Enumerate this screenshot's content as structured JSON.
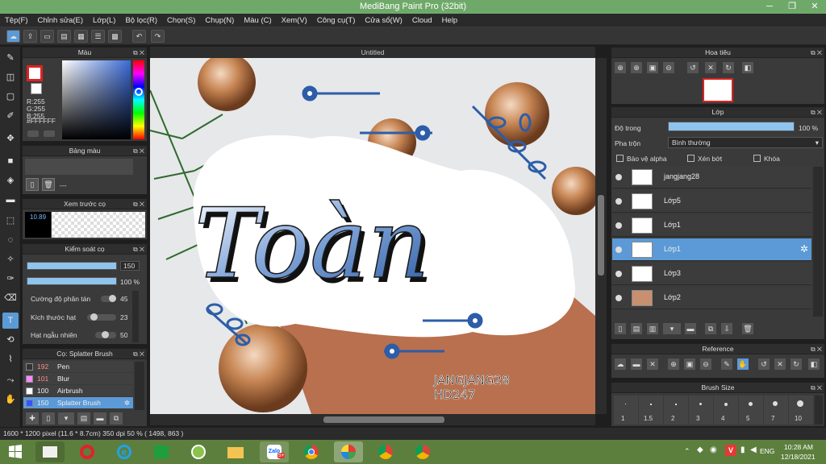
{
  "app": {
    "title": "MediBang Paint Pro (32bit)"
  },
  "menu": [
    "Tệp(F)",
    "Chỉnh sửa(E)",
    "Lớp(L)",
    "Bộ lọc(R)",
    "Chọn(S)",
    "Chụp(N)",
    "Màu (C)",
    "Xem(V)",
    "Công cụ(T)",
    "Cửa sổ(W)",
    "Cloud",
    "Help"
  ],
  "color_panel": {
    "title": "Màu",
    "r": "R:255",
    "g": "G:255",
    "b": "B:255",
    "hex": "#FFFFFF"
  },
  "palette_panel": {
    "title": "Bảng màu",
    "dashes": "---"
  },
  "brush_preview": {
    "title": "Xem trước cọ",
    "size": "10.89"
  },
  "brush_control": {
    "title": "Kiểm soát cọ",
    "size_value": "150",
    "opacity_value": "100 %",
    "scatter_label": "Cường độ phân tán",
    "scatter_value": "45",
    "particle_label": "Kích thước hạt",
    "particle_value": "23",
    "random_label": "Hạt ngẫu nhiên",
    "random_value": "50",
    "size_fill": 1.0,
    "opacity_fill": 1.0
  },
  "brush_list": {
    "title": "Cọ: Splatter Brush",
    "items": [
      {
        "num": "192",
        "name": "Pen",
        "color": "#333333"
      },
      {
        "num": "101",
        "name": "Blur",
        "color": "#ff88ff"
      },
      {
        "num": "100",
        "name": "Airbrush",
        "color": "#ffffff"
      },
      {
        "num": "150",
        "name": "Splatter Brush",
        "color": "#3355ff"
      }
    ]
  },
  "document": {
    "tab": "Untitled"
  },
  "artwork": {
    "title_text": "Toàn",
    "caption_line1": "JANGJANG28",
    "caption_line2": "HD247"
  },
  "navigator": {
    "title": "Hoa tiêu"
  },
  "layers": {
    "title": "Lớp",
    "opacity_label": "Độ trong",
    "opacity_value": "100 %",
    "opacity_fill": 1.0,
    "blend_label": "Pha trộn",
    "blend_value": "Bình thường",
    "protect_alpha": "Bảo vệ alpha",
    "clipping": "Xén bớt",
    "lock": "Khóa",
    "items": [
      "jangjang28",
      "Lớp5",
      "Lớp1",
      "Lớp1",
      "Lớp3",
      "Lớp2"
    ]
  },
  "reference": {
    "title": "Reference"
  },
  "brush_size": {
    "title": "Brush Size",
    "sizes": [
      "1",
      "1.5",
      "2",
      "3",
      "4",
      "5",
      "7",
      "10"
    ]
  },
  "status": {
    "text": "1600 * 1200 pixel  (11.6 * 8.7cm)  350 dpi  50 %  ( 1498, 863 )"
  },
  "taskbar": {
    "lang": "ENG",
    "time": "10:28 AM",
    "date": "12/18/2021",
    "zalo_badge": "5+"
  },
  "colors": {
    "accent": "#5b9ad6",
    "titlebar": "#6fa96a",
    "taskbar": "#5d7f3e"
  }
}
